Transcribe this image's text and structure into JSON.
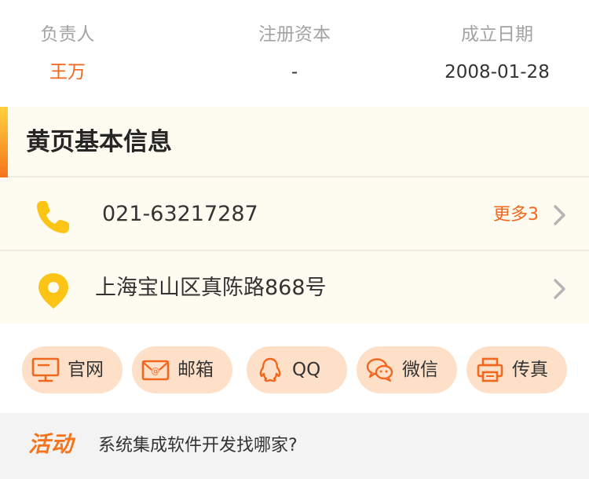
{
  "info": {
    "columns": [
      {
        "label": "负责人",
        "value": "王万"
      },
      {
        "label": "注册资本",
        "value": "-"
      },
      {
        "label": "成立日期",
        "value": "2008-01-28"
      }
    ]
  },
  "yellow_pages": {
    "title": "黄页基本信息",
    "phone": {
      "icon": "phone-icon",
      "number": "021-63217287",
      "more": "更多3"
    },
    "address": {
      "icon": "location-pin-icon",
      "text": "上海宝山区真陈路868号"
    }
  },
  "contact_buttons": [
    {
      "label": "官网",
      "icon": "monitor-icon"
    },
    {
      "label": "邮箱",
      "icon": "email-icon"
    },
    {
      "label": "QQ",
      "icon": "qq-icon"
    },
    {
      "label": "微信",
      "icon": "wechat-icon"
    },
    {
      "label": "传真",
      "icon": "printer-icon"
    }
  ],
  "activity": {
    "tag": "活动",
    "text": "系统集成软件开发找哪家?"
  },
  "colors": {
    "accent_orange": "#f2661e",
    "icon_yellow": "#fcc415",
    "pill_bg": "#fee0c8",
    "card_bg": "#fefcf0"
  }
}
